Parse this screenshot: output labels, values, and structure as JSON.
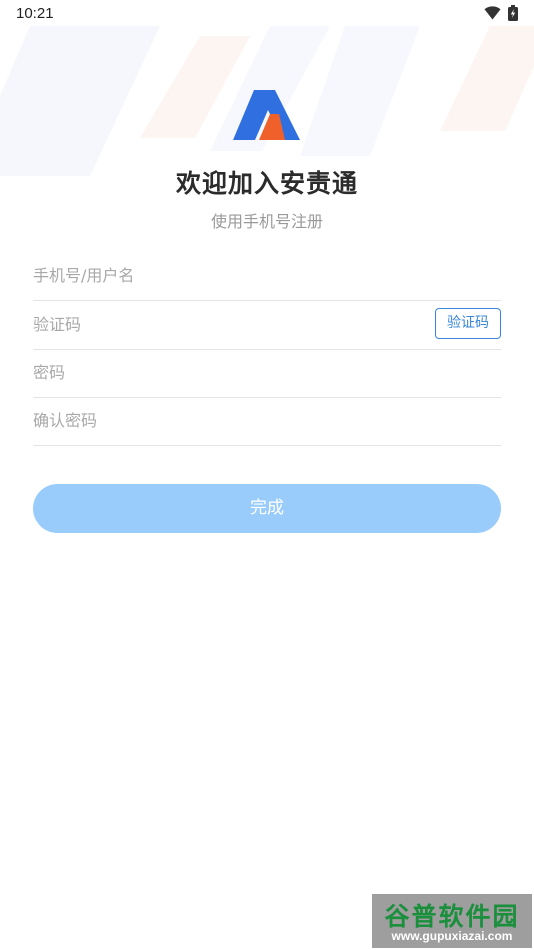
{
  "status_bar": {
    "time": "10:21",
    "icons": [
      "wifi-icon",
      "battery-charging-icon"
    ]
  },
  "header": {
    "logo_icon": "app-logo-icon",
    "title": "欢迎加入安责通",
    "subtitle": "使用手机号注册"
  },
  "form": {
    "phone_placeholder": "手机号/用户名",
    "phone_value": "",
    "code_placeholder": "验证码",
    "code_value": "",
    "code_button_label": "验证码",
    "password_placeholder": "密码",
    "password_value": "",
    "confirm_placeholder": "确认密码",
    "confirm_value": "",
    "submit_label": "完成"
  },
  "watermark": {
    "name": "谷普软件园",
    "url": "www.gupuxiazai.com"
  },
  "colors": {
    "accent": "#3a86d9",
    "submit_bg": "#99ccfb",
    "logo_blue": "#2f6fe0",
    "logo_orange": "#f0602a",
    "title_text": "#2b2b2b",
    "subtitle_text": "#9a9a9a",
    "divider": "#e4e4e4"
  }
}
